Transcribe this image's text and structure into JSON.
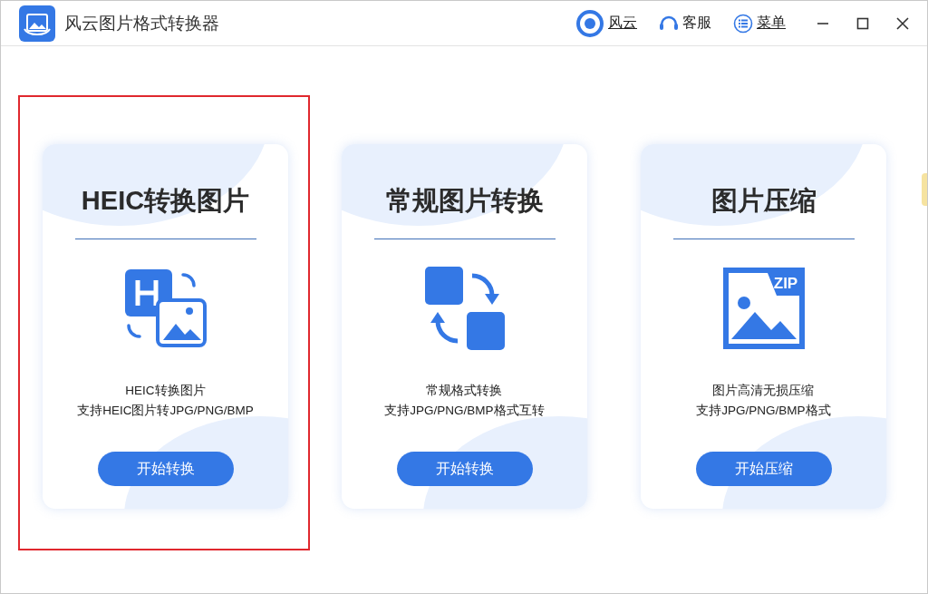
{
  "window": {
    "title": "风云图片格式转换器"
  },
  "header_links": [
    {
      "kind": "brand",
      "label": "风云"
    },
    {
      "kind": "support",
      "label": "客服"
    },
    {
      "kind": "menu",
      "label": "菜单"
    }
  ],
  "cards": [
    {
      "kind": "heic",
      "title": "HEIC转换图片",
      "description": [
        "HEIC转换图片",
        "支持HEIC图片转JPG/PNG/BMP"
      ],
      "button": "开始转换",
      "highlighted": true
    },
    {
      "kind": "convert",
      "title": "常规图片转换",
      "description": [
        "常规格式转换",
        "支持JPG/PNG/BMP格式互转"
      ],
      "button": "开始转换",
      "highlighted": false
    },
    {
      "kind": "zip",
      "title": "图片压缩",
      "icon_label": "ZIP",
      "description": [
        "图片高清无损压缩",
        "支持JPG/PNG/BMP格式"
      ],
      "button": "开始压缩",
      "highlighted": false
    }
  ]
}
